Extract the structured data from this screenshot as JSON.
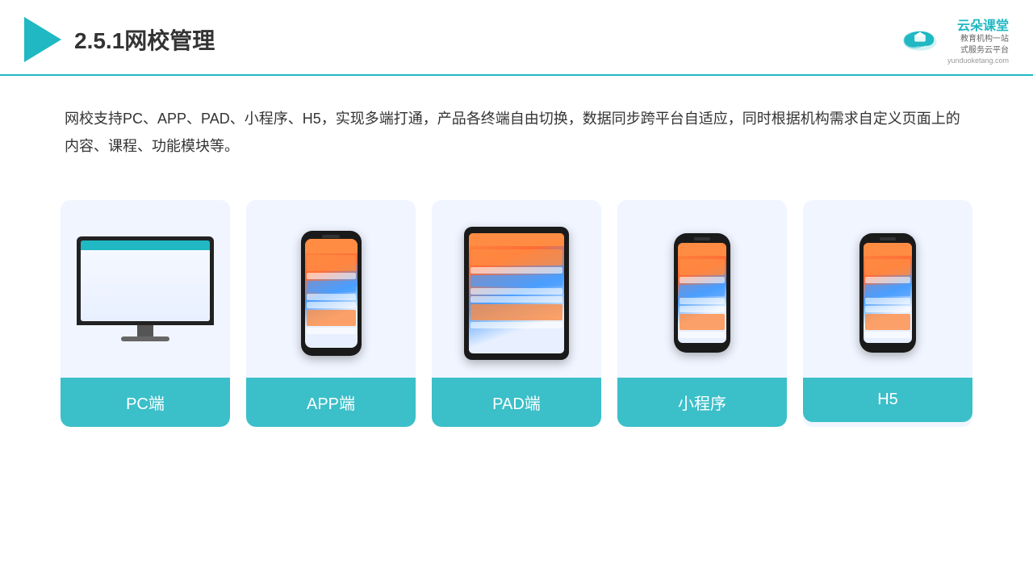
{
  "header": {
    "title": "2.5.1网校管理",
    "brand_name": "云朵课堂",
    "brand_url": "yunduoketang.com",
    "brand_tagline_line1": "教育机构一站",
    "brand_tagline_line2": "式服务云平台"
  },
  "description": {
    "text": "网校支持PC、APP、PAD、小程序、H5，实现多端打通，产品各终端自由切换，数据同步跨平台自适应，同时根据机构需求自定义页面上的内容、课程、功能模块等。"
  },
  "cards": [
    {
      "id": "pc",
      "label": "PC端"
    },
    {
      "id": "app",
      "label": "APP端"
    },
    {
      "id": "pad",
      "label": "PAD端"
    },
    {
      "id": "miniapp",
      "label": "小程序"
    },
    {
      "id": "h5",
      "label": "H5"
    }
  ]
}
